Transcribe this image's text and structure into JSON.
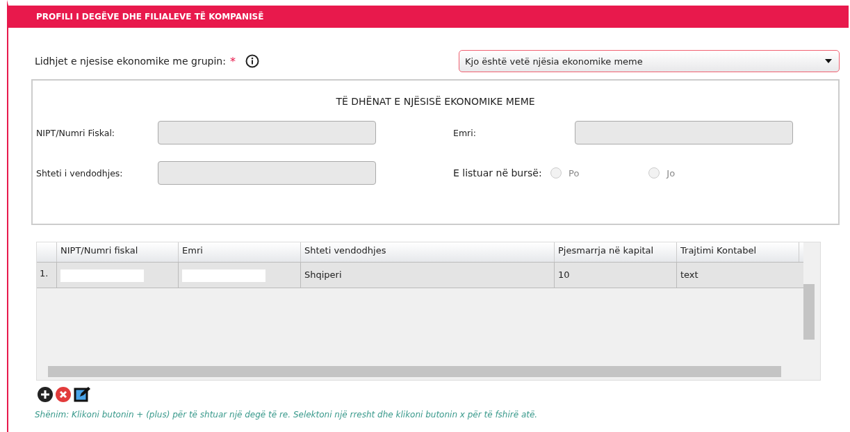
{
  "header": {
    "title": "PROFILI I DEGËVE DHE FILIALEVE TË KOMPANISË"
  },
  "relation": {
    "label": "Lidhjet e njesise ekonomike me grupin:",
    "required_mark": "*",
    "value": "Kjo është vetë njësia ekonomike meme"
  },
  "parent_unit": {
    "title": "TË DHËNAT E NJËSISË EKONOMIKE MEME",
    "fields": [
      {
        "label": "NIPT/Numri Fiskal:",
        "disabled": true
      },
      {
        "label": "Emri:",
        "disabled": true
      },
      {
        "label": "Shteti i vendodhjes:",
        "disabled": true
      }
    ],
    "listed": {
      "label": "E listuar në bursë:",
      "options": [
        {
          "label": "Po",
          "selected": false
        },
        {
          "label": "Jo",
          "selected": false
        }
      ]
    }
  },
  "table": {
    "columns": [
      "NIPT/Numri fiskal",
      "Emri",
      "Shteti vendodhjes",
      "Pjesmarrja në kapital",
      "Trajtimi Kontabel"
    ],
    "rows": [
      {
        "number": "1.",
        "cells": [
          {
            "kind": "redacted"
          },
          {
            "kind": "redacted"
          },
          {
            "kind": "text",
            "text": "Shqiperi"
          },
          {
            "kind": "text",
            "text": "10"
          },
          {
            "kind": "text",
            "text": "text"
          }
        ]
      }
    ]
  },
  "note": "Shënim: Klikoni butonin + (plus) për të shtuar një degë të re. Selektoni një rresht dhe klikoni butonin x për të fshirë atë."
}
